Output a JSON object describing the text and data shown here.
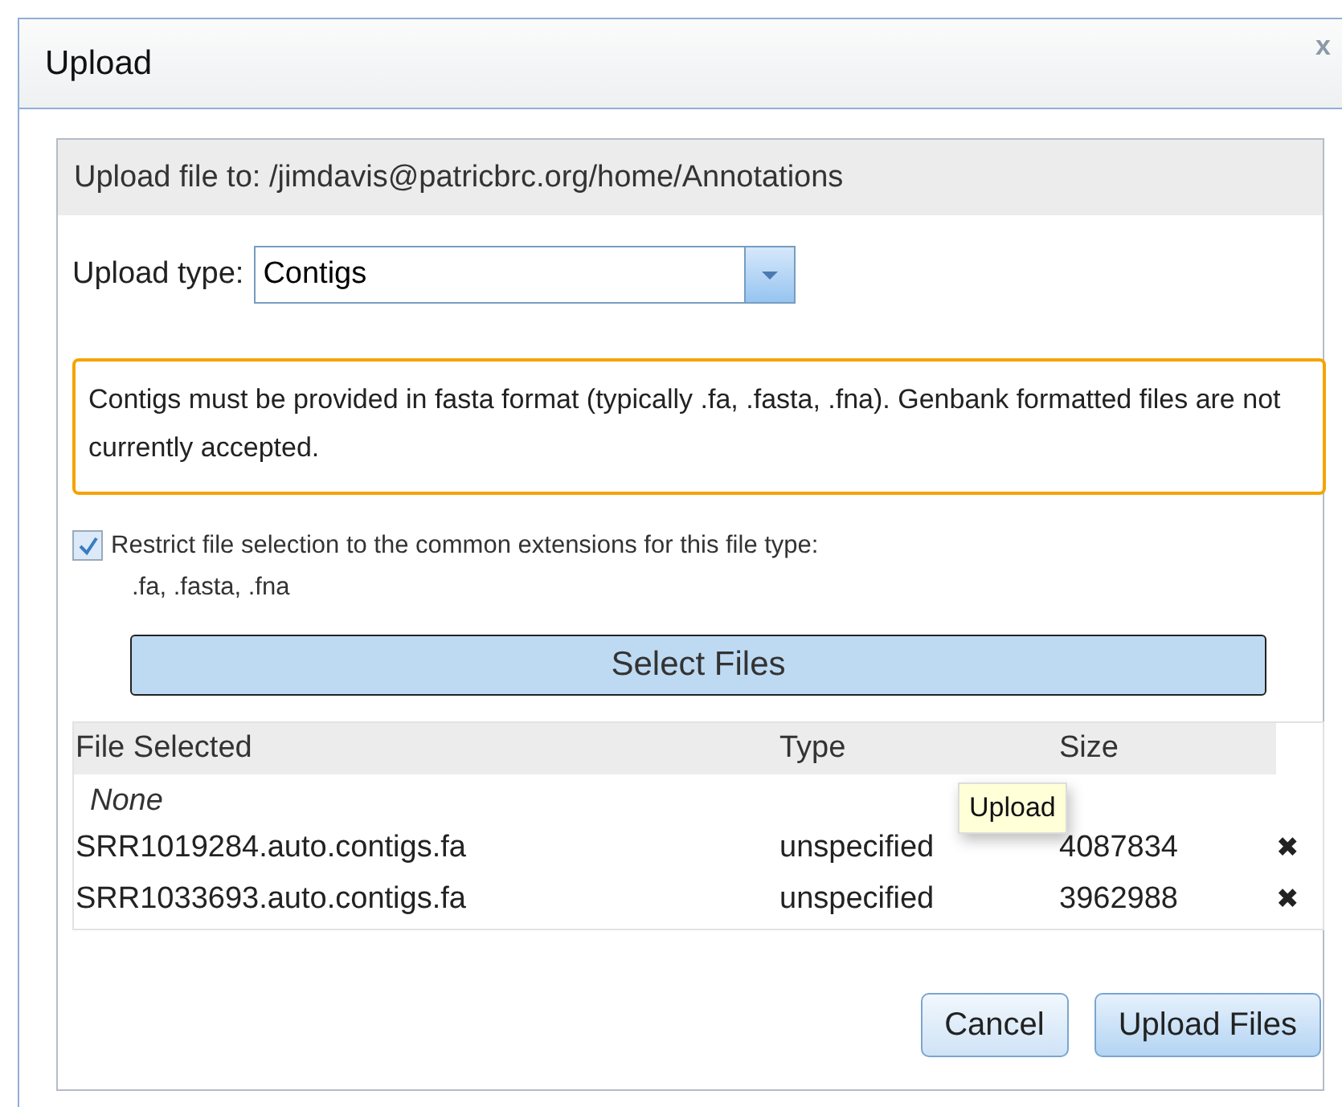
{
  "dialog": {
    "title": "Upload",
    "close": "x"
  },
  "destination": "Upload file to: /jimdavis@patricbrc.org/home/Annotations",
  "upload_type": {
    "label": "Upload type:",
    "value": "Contigs"
  },
  "notice": "Contigs must be provided in fasta format (typically .fa, .fasta, .fna). Genbank formatted files are not currently accepted.",
  "restrict": {
    "label": "Restrict file selection to the common extensions for this file type:",
    "extensions": ".fa, .fasta, .fna",
    "checked": true
  },
  "select_button": "Select Files",
  "table": {
    "columns": [
      "File Selected",
      "Type",
      "Size"
    ],
    "empty_text": "None",
    "rows": [
      {
        "file": "SRR1019284.auto.contigs.fa",
        "type": "unspecified",
        "size": "4087834",
        "remove": "✖"
      },
      {
        "file": "SRR1033693.auto.contigs.fa",
        "type": "unspecified",
        "size": "3962988",
        "remove": "✖"
      }
    ]
  },
  "tooltip": "Upload",
  "buttons": [
    "Cancel",
    "Upload Files"
  ]
}
